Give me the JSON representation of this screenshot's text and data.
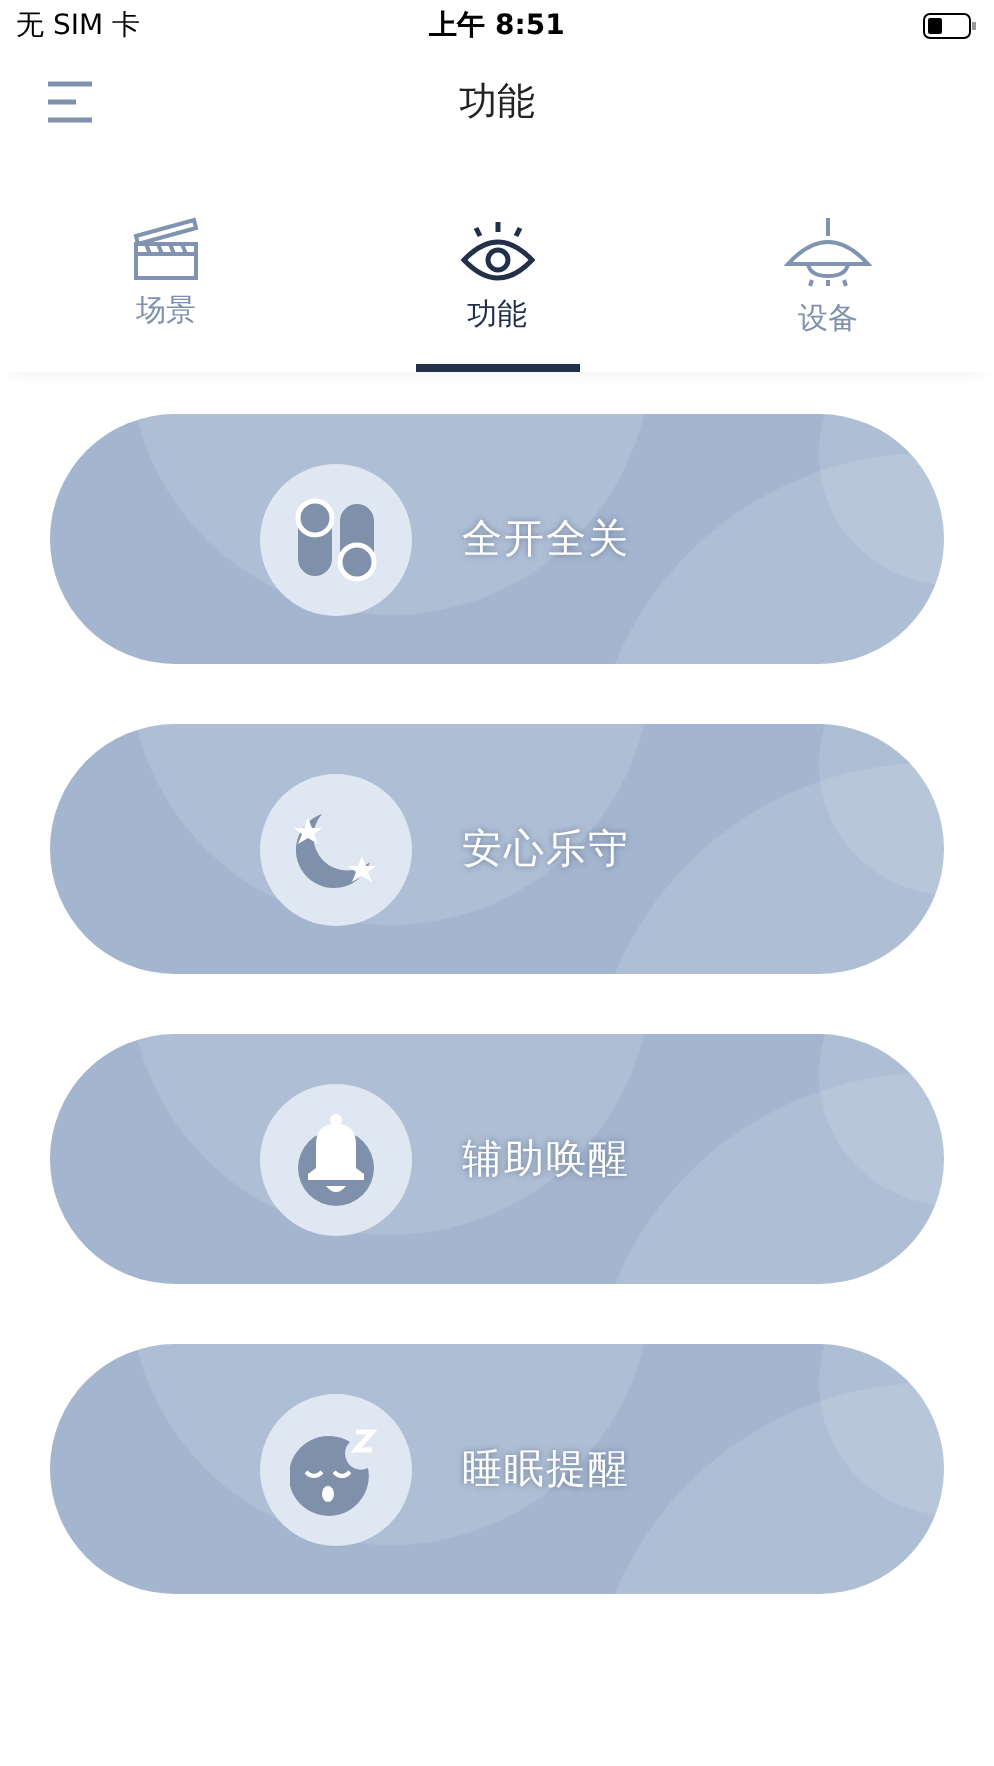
{
  "status_bar": {
    "carrier": "无 SIM 卡",
    "time": "上午 8:51"
  },
  "header": {
    "title": "功能"
  },
  "tabs": [
    {
      "label": "场景",
      "kind": "scene",
      "selected": false
    },
    {
      "label": "功能",
      "kind": "function",
      "selected": true
    },
    {
      "label": "设备",
      "kind": "device",
      "selected": false
    }
  ],
  "cards": [
    {
      "label": "全开全关",
      "kind": "switches"
    },
    {
      "label": "安心乐守",
      "kind": "moon"
    },
    {
      "label": "辅助唤醒",
      "kind": "bell"
    },
    {
      "label": "睡眠提醒",
      "kind": "sleep"
    }
  ]
}
